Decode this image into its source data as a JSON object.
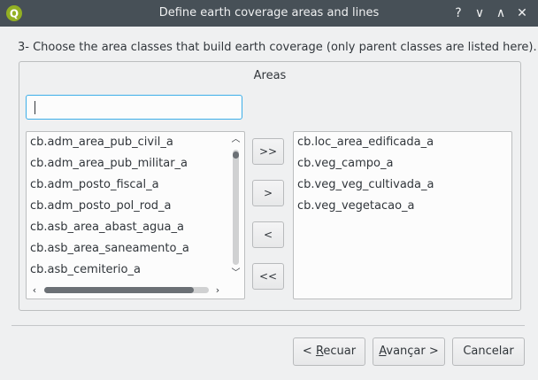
{
  "window": {
    "title": "Define earth coverage areas and lines",
    "help_label": "?",
    "minimize_label": "∨",
    "maximize_label": "∧",
    "close_label": "✕",
    "app_icon": "qgis-icon"
  },
  "wizard": {
    "instruction": "3- Choose the area classes that build earth coverage (only parent classes are listed here).",
    "group_title": "Areas",
    "search_value": "",
    "available": [
      "cb.adm_area_pub_civil_a",
      "cb.adm_area_pub_militar_a",
      "cb.adm_posto_fiscal_a",
      "cb.adm_posto_pol_rod_a",
      "cb.asb_area_abast_agua_a",
      "cb.asb_area_saneamento_a",
      "cb.asb_cemiterio_a"
    ],
    "selected": [
      "cb.loc_area_edificada_a",
      "cb.veg_campo_a",
      "cb.veg_veg_cultivada_a",
      "cb.veg_vegetacao_a"
    ],
    "move_buttons": {
      "add_all": ">>",
      "add": ">",
      "remove": "<",
      "remove_all": "<<"
    }
  },
  "footer": {
    "back_prefix": "< ",
    "back_underlined": "R",
    "back_rest": "ecuar",
    "next_underlined": "A",
    "next_rest": "vançar >",
    "cancel": "Cancelar"
  }
}
